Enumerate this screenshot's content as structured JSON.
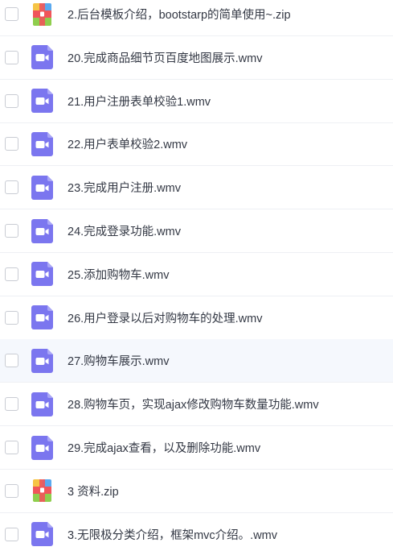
{
  "files": [
    {
      "name": "2.后台模板介绍，bootstarp的简单使用~.zip",
      "icon": "zip-icon"
    },
    {
      "name": "20.完成商品细节页百度地图展示.wmv",
      "icon": "video-icon"
    },
    {
      "name": "21.用户注册表单校验1.wmv",
      "icon": "video-icon"
    },
    {
      "name": "22.用户表单校验2.wmv",
      "icon": "video-icon"
    },
    {
      "name": "23.完成用户注册.wmv",
      "icon": "video-icon"
    },
    {
      "name": "24.完成登录功能.wmv",
      "icon": "video-icon"
    },
    {
      "name": "25.添加购物车.wmv",
      "icon": "video-icon"
    },
    {
      "name": "26.用户登录以后对购物车的处理.wmv",
      "icon": "video-icon"
    },
    {
      "name": "27.购物车展示.wmv",
      "icon": "video-icon",
      "hovered": true
    },
    {
      "name": "28.购物车页，实现ajax修改购物车数量功能.wmv",
      "icon": "video-icon"
    },
    {
      "name": "29.完成ajax查看，以及删除功能.wmv",
      "icon": "video-icon"
    },
    {
      "name": "3 资料.zip",
      "icon": "zip-icon"
    },
    {
      "name": "3.无限极分类介绍，框架mvc介绍。.wmv",
      "icon": "video-icon"
    }
  ],
  "colors": {
    "video_icon": "#7b76ef",
    "video_icon_fold": "#a9a6f6",
    "zip_red": "#f0555a",
    "zip_blue": "#5aa9ef",
    "zip_green": "#8fce4d",
    "zip_yellow": "#f6c445"
  }
}
